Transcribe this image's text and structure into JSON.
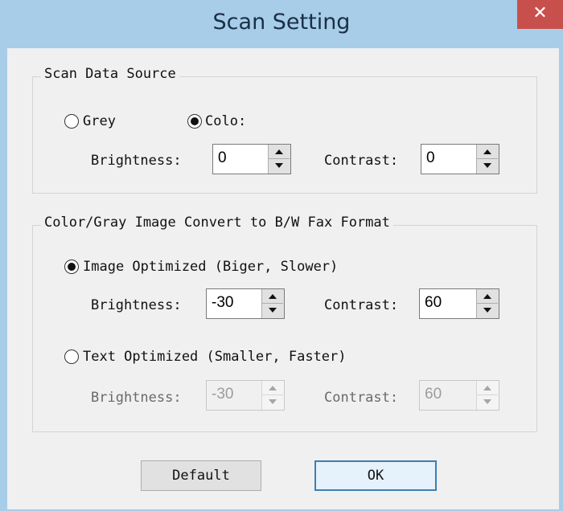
{
  "window": {
    "title": "Scan Setting",
    "close_glyph": "✕"
  },
  "scan_source": {
    "group_label": "Scan Data Source",
    "grey_label": "Grey",
    "color_label": "Colo:",
    "selected": "color",
    "brightness_label": "Brightness:",
    "brightness_value": "0",
    "contrast_label": "Contrast:",
    "contrast_value": "0"
  },
  "fax_convert": {
    "group_label": "Color/Gray Image Convert to B/W Fax Format",
    "image_opt_label": "Image Optimized (Biger, Slower)",
    "image_brightness_label": "Brightness:",
    "image_brightness_value": "-30",
    "image_contrast_label": "Contrast:",
    "image_contrast_value": "60",
    "text_opt_label": "Text Optimized (Smaller, Faster)",
    "text_brightness_label": "Brightness:",
    "text_brightness_value": "-30",
    "text_contrast_label": "Contrast:",
    "text_contrast_value": "60",
    "selected": "image"
  },
  "buttons": {
    "default_label": "Default",
    "ok_label": "OK"
  },
  "colors": {
    "title_bar": "#a7cde9",
    "close_button": "#c7504d",
    "client_bg": "#f0f0f0"
  }
}
